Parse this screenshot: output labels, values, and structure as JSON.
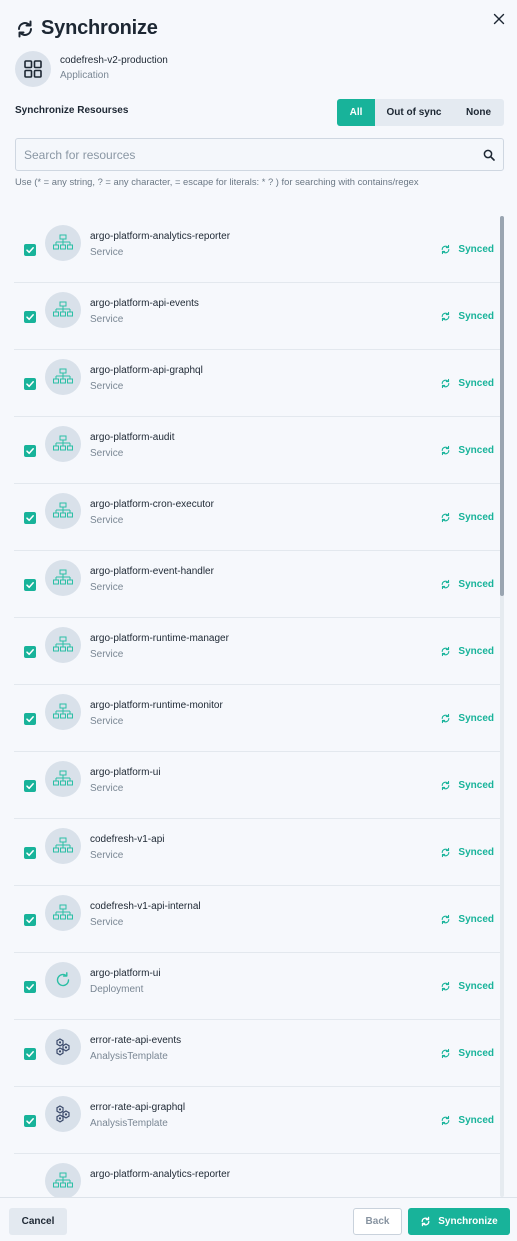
{
  "header": {
    "title": "Synchronize",
    "app_name": "codefresh-v2-production",
    "app_kind": "Application"
  },
  "section_label": "Synchronize Resourses",
  "filters": [
    {
      "label": "All",
      "active": true
    },
    {
      "label": "Out of sync",
      "active": false
    },
    {
      "label": "None",
      "active": false
    }
  ],
  "search": {
    "value": "",
    "placeholder": "Search for resources",
    "hint": "Use (* = any string, ? = any character, = escape for literals: * ? ) for searching with contains/regex"
  },
  "resources": [
    {
      "name": "argo-platform-analytics-reporter",
      "kind": "Service",
      "icon": "service-icon",
      "status": "Synced",
      "checked": true
    },
    {
      "name": "argo-platform-api-events",
      "kind": "Service",
      "icon": "service-icon",
      "status": "Synced",
      "checked": true
    },
    {
      "name": "argo-platform-api-graphql",
      "kind": "Service",
      "icon": "service-icon",
      "status": "Synced",
      "checked": true
    },
    {
      "name": "argo-platform-audit",
      "kind": "Service",
      "icon": "service-icon",
      "status": "Synced",
      "checked": true
    },
    {
      "name": "argo-platform-cron-executor",
      "kind": "Service",
      "icon": "service-icon",
      "status": "Synced",
      "checked": true
    },
    {
      "name": "argo-platform-event-handler",
      "kind": "Service",
      "icon": "service-icon",
      "status": "Synced",
      "checked": true
    },
    {
      "name": "argo-platform-runtime-manager",
      "kind": "Service",
      "icon": "service-icon",
      "status": "Synced",
      "checked": true
    },
    {
      "name": "argo-platform-runtime-monitor",
      "kind": "Service",
      "icon": "service-icon",
      "status": "Synced",
      "checked": true
    },
    {
      "name": "argo-platform-ui",
      "kind": "Service",
      "icon": "service-icon",
      "status": "Synced",
      "checked": true
    },
    {
      "name": "codefresh-v1-api",
      "kind": "Service",
      "icon": "service-icon",
      "status": "Synced",
      "checked": true
    },
    {
      "name": "codefresh-v1-api-internal",
      "kind": "Service",
      "icon": "service-icon",
      "status": "Synced",
      "checked": true
    },
    {
      "name": "argo-platform-ui",
      "kind": "Deployment",
      "icon": "deployment-icon",
      "status": "Synced",
      "checked": true
    },
    {
      "name": "error-rate-api-events",
      "kind": "AnalysisTemplate",
      "icon": "analysis-template-icon",
      "status": "Synced",
      "checked": true
    },
    {
      "name": "error-rate-api-graphql",
      "kind": "AnalysisTemplate",
      "icon": "analysis-template-icon",
      "status": "Synced",
      "checked": true
    },
    {
      "name": "argo-platform-analytics-reporter",
      "kind": "",
      "icon": "service-icon",
      "status": "",
      "checked": false
    }
  ],
  "footer": {
    "cancel_label": "Cancel",
    "back_label": "Back",
    "sync_label": "Synchronize"
  },
  "colors": {
    "accent": "#18b39a",
    "text": "#1d2733",
    "muted": "#7a8794",
    "background": "#f6f8fc"
  }
}
